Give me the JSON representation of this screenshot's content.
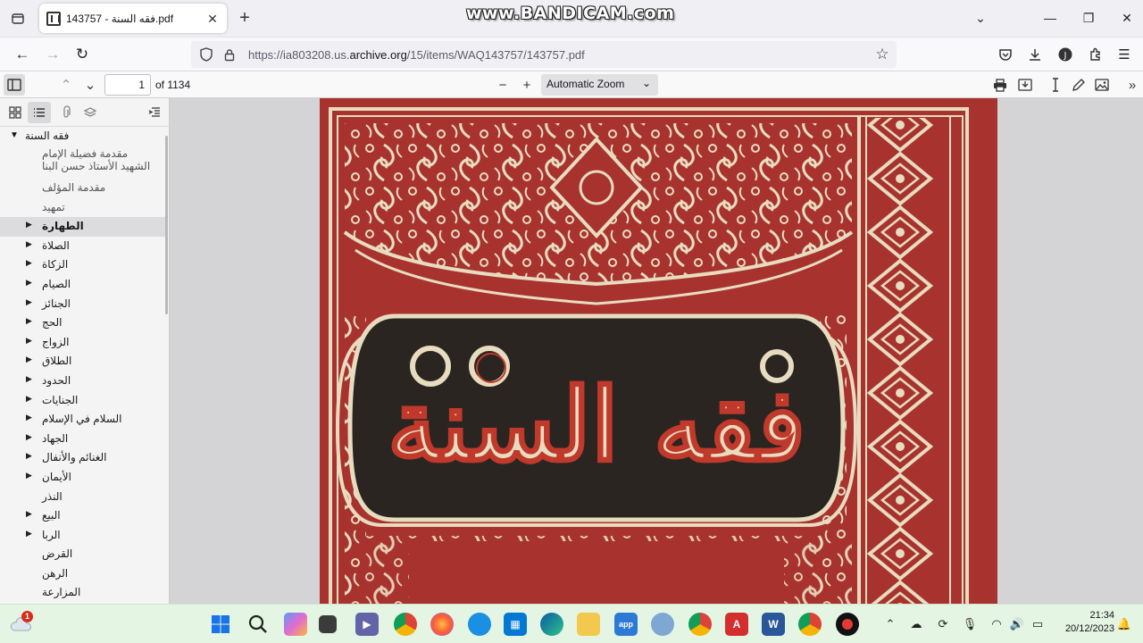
{
  "browser": {
    "tab_title": "فقه السنة - 143757.pdf",
    "watermark": "www.BANDICAM.com",
    "url_prefix": "https://ia803208.us.",
    "url_domain": "archive.org",
    "url_path": "/15/items/WAQ143757/143757.pdf"
  },
  "pdf_toolbar": {
    "page_number": "1",
    "page_count": "of 1134",
    "zoom": "Automatic Zoom"
  },
  "outline": {
    "root": "فقه السنة",
    "items": [
      {
        "label": "مقدمة فضيلة الإمام الشهيد الأستاذ حسن البنا",
        "expandable": false
      },
      {
        "label": "مقدمة المؤلف",
        "expandable": false
      },
      {
        "label": "تمهيد",
        "expandable": false
      },
      {
        "label": "الطهارة",
        "expandable": true
      },
      {
        "label": "الصلاة",
        "expandable": true
      },
      {
        "label": "الزكاة",
        "expandable": true
      },
      {
        "label": "الصيام",
        "expandable": true
      },
      {
        "label": "الجنائز",
        "expandable": true
      },
      {
        "label": "الحج",
        "expandable": true
      },
      {
        "label": "الزواج",
        "expandable": true
      },
      {
        "label": "الطلاق",
        "expandable": true
      },
      {
        "label": "الحدود",
        "expandable": true
      },
      {
        "label": "الجنايات",
        "expandable": true
      },
      {
        "label": "السلام في الإسلام",
        "expandable": true
      },
      {
        "label": "الجهاد",
        "expandable": true
      },
      {
        "label": "الغنائم والأنفال",
        "expandable": true
      },
      {
        "label": "الأيمان",
        "expandable": true
      },
      {
        "label": "النذر",
        "expandable": false
      },
      {
        "label": "البيع",
        "expandable": true
      },
      {
        "label": "الربا",
        "expandable": true
      },
      {
        "label": "القرض",
        "expandable": false
      },
      {
        "label": "الرهن",
        "expandable": false
      },
      {
        "label": "المزارعة",
        "expandable": false
      }
    ]
  },
  "document": {
    "cover_title": "فقه السنة"
  },
  "taskbar": {
    "notification_count": "1",
    "time": "21:34",
    "date": "20/12/2023"
  },
  "colors": {
    "cover_red": "#a8332e",
    "cover_gold": "#e8dcc0",
    "cover_dark": "#2b2522",
    "taskbar_bg": "#e4f5e4"
  }
}
